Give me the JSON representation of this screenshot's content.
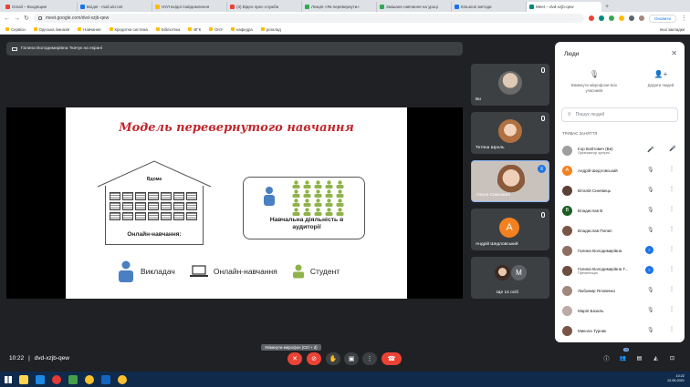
{
  "browser": {
    "tabs": [
      {
        "title": "Gmail – Входящие",
        "color": "#ea4335"
      },
      {
        "title": "Вхідні - mail.ukr.net",
        "color": "#1a73e8"
      },
      {
        "title": "НУЛ вхідні повідомлення",
        "color": "#fbbc04"
      },
      {
        "title": "(3) Відео прес-служби",
        "color": "#ea4335"
      },
      {
        "title": "Лекція «Як перевернути»",
        "color": "#34a853"
      },
      {
        "title": "Змішане навчання на уроці",
        "color": "#34a853"
      },
      {
        "title": "Кількісні методи",
        "color": "#1a73e8"
      },
      {
        "title": "Meet – dvd-xzjb-qew",
        "color": "#00897b"
      }
    ],
    "url": "meet.google.com/dvd-xzjb-qew",
    "update_label": "Оновити",
    "bookmarks": [
      "Сервіси",
      "Одеська гімназія",
      "Навчання",
      "Кредитна система",
      "Бібліотека",
      "ВГК",
      "ОНУ",
      "кафедра",
      "розклад"
    ],
    "bookmarks_right": "Інші закладки"
  },
  "meet": {
    "presenter_bar": "Галина Володимирівна Ткачук на екрані",
    "slide": {
      "title": "Модель перевернутого навчання",
      "house_top_label": "Вдома",
      "house_bottom_label": "Онлайн-навчання:",
      "class_label": "Навчальна діяльність в аудиторії",
      "legend": [
        "Викладач",
        "Онлайн-навчання",
        "Студент"
      ]
    },
    "tiles": [
      {
        "name": "Ви"
      },
      {
        "name": "Тетяна Шроль"
      },
      {
        "name": "Ольга Самохвал"
      },
      {
        "name": "Андрій Шедловський",
        "initial": "А"
      },
      {
        "name": "Ще 14 осіб",
        "initial": "М"
      }
    ],
    "clock": "10:22",
    "meeting_code": "dvd-xzjb-qew",
    "mic_tooltip": "Увімкнути мікрофон (Ctrl + d)",
    "participants_count": "18",
    "controls": {
      "mic": "mic-off-icon",
      "camera": "camera-off-icon",
      "hand": "hand-icon",
      "present": "present-icon",
      "more": "more-icon",
      "hangup": "hangup-icon"
    }
  },
  "panel": {
    "title": "Люди",
    "action_mute": "Вимкнути мікрофони всіх учасників",
    "action_add": "Додати людей",
    "search_placeholder": "Пошук людей",
    "section_label": "ТРИВАЄ ЗАНЯТТЯ",
    "people": [
      {
        "name": "Ігор Войтович (Ви)",
        "sub": "Організатор зустрічі",
        "color": "#9e9e9e",
        "initial": "",
        "state": "mic"
      },
      {
        "name": "Андрій Шедловський",
        "sub": "",
        "color": "#f4811f",
        "initial": "А",
        "state": "muted"
      },
      {
        "name": "Віталій Синявець",
        "sub": "",
        "color": "#5d4037",
        "initial": "",
        "state": "muted"
      },
      {
        "name": "Владислав В",
        "sub": "",
        "color": "#1b5e20",
        "initial": "В",
        "state": "muted"
      },
      {
        "name": "Владислав Пилип",
        "sub": "",
        "color": "#795548",
        "initial": "",
        "state": "muted"
      },
      {
        "name": "Галина Володимирівна",
        "sub": "",
        "color": "#8d6e63",
        "initial": "",
        "state": "speaking"
      },
      {
        "name": "Галина Володимирівна Т...",
        "sub": "Презентація",
        "color": "#6d4c41",
        "initial": "",
        "state": "speaking"
      },
      {
        "name": "Любомир Яловенко",
        "sub": "",
        "color": "#a1887f",
        "initial": "",
        "state": "muted"
      },
      {
        "name": "Марія Базиль",
        "sub": "",
        "color": "#bcaaa4",
        "initial": "",
        "state": "muted"
      },
      {
        "name": "Микола Турник",
        "sub": "",
        "color": "#795548",
        "initial": "",
        "state": "muted"
      }
    ]
  },
  "taskbar": {
    "time": "10:22",
    "date": "12.05.2021"
  }
}
